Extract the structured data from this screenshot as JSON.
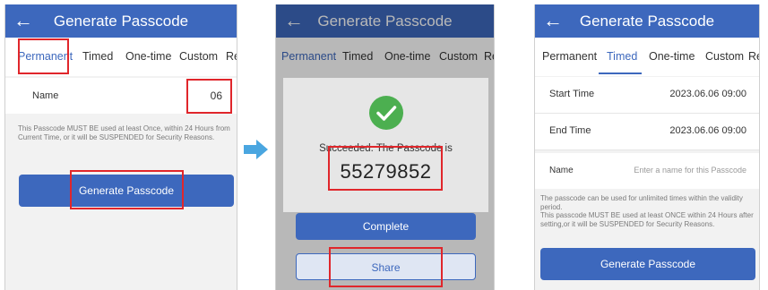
{
  "panel1": {
    "title": "Generate Passcode",
    "tabs": [
      "Permanent",
      "Timed",
      "One-time",
      "Custom",
      "Rec"
    ],
    "name_label": "Name",
    "name_value": "06",
    "note": "This Passcode MUST BE used at least Once, within 24 Hours from Current Time, or it will be SUSPENDED for Security Reasons.",
    "generate_label": "Generate Passcode"
  },
  "panel2": {
    "title": "Generate Passcode",
    "tabs": [
      "Permanent",
      "Timed",
      "One-time",
      "Custom",
      "Rec"
    ],
    "success_text": "Succeeded. The Passcode is",
    "passcode": "55279852",
    "complete_label": "Complete",
    "share_label": "Share"
  },
  "panel3": {
    "title": "Generate Passcode",
    "tabs": [
      "Permanent",
      "Timed",
      "One-time",
      "Custom",
      "Rec"
    ],
    "start_label": "Start Time",
    "start_value": "2023.06.06 09:00",
    "end_label": "End Time",
    "end_value": "2023.06.06 09:00",
    "name_label": "Name",
    "name_placeholder": "Enter a name for this Passcode",
    "note1": "The passcode can be used for unlimited times within the validity period.",
    "note2": "This passcode MUST BE used at least ONCE within 24 Hours after setting,or it will be SUSPENDED for Security Reasons.",
    "generate_label": "Generate Passcode"
  },
  "colors": {
    "primary": "#3d68bd",
    "highlight": "#e0262b",
    "success": "#4caf50",
    "arrow": "#4aa6e0"
  },
  "icons": {
    "back": "arrow-left-icon",
    "success": "check-circle-icon",
    "flow": "arrow-right-icon"
  }
}
